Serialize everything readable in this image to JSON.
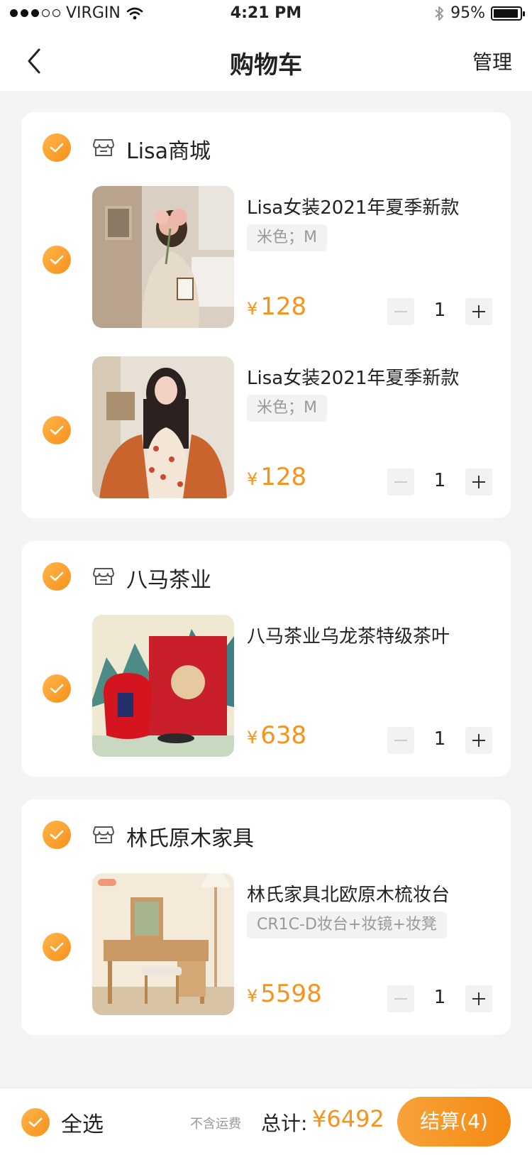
{
  "status_bar": {
    "carrier": "VIRGIN",
    "time": "4:21 PM",
    "battery": "95%",
    "battery_level": 0.95
  },
  "nav": {
    "title": "购物车",
    "manage": "管理"
  },
  "stores": [
    {
      "name": "Lisa商城",
      "items": [
        {
          "title": "Lisa女装2021年夏季新款",
          "spec": "米色；M",
          "price_symbol": "¥",
          "price": "128",
          "qty": "1"
        },
        {
          "title": "Lisa女装2021年夏季新款",
          "spec": "米色；M",
          "price_symbol": "¥",
          "price": "128",
          "qty": "1"
        }
      ]
    },
    {
      "name": "八马茶业",
      "items": [
        {
          "title": "八马茶业乌龙茶特级茶叶",
          "spec": "",
          "price_symbol": "¥",
          "price": "638",
          "qty": "1"
        }
      ]
    },
    {
      "name": "林氏原木家具",
      "items": [
        {
          "title": "林氏家具北欧原木梳妆台",
          "spec": "CR1C-D妆台+妆镜+妆凳",
          "price_symbol": "¥",
          "price": "5598",
          "qty": "1"
        }
      ]
    }
  ],
  "bottom_bar": {
    "select_all": "全选",
    "shipping_note": "不含运费",
    "total_label": "总计:",
    "total": "¥6492",
    "checkout": "结算(4)"
  },
  "colors": {
    "accent": "#f7921d",
    "background": "#f4f4f4"
  }
}
